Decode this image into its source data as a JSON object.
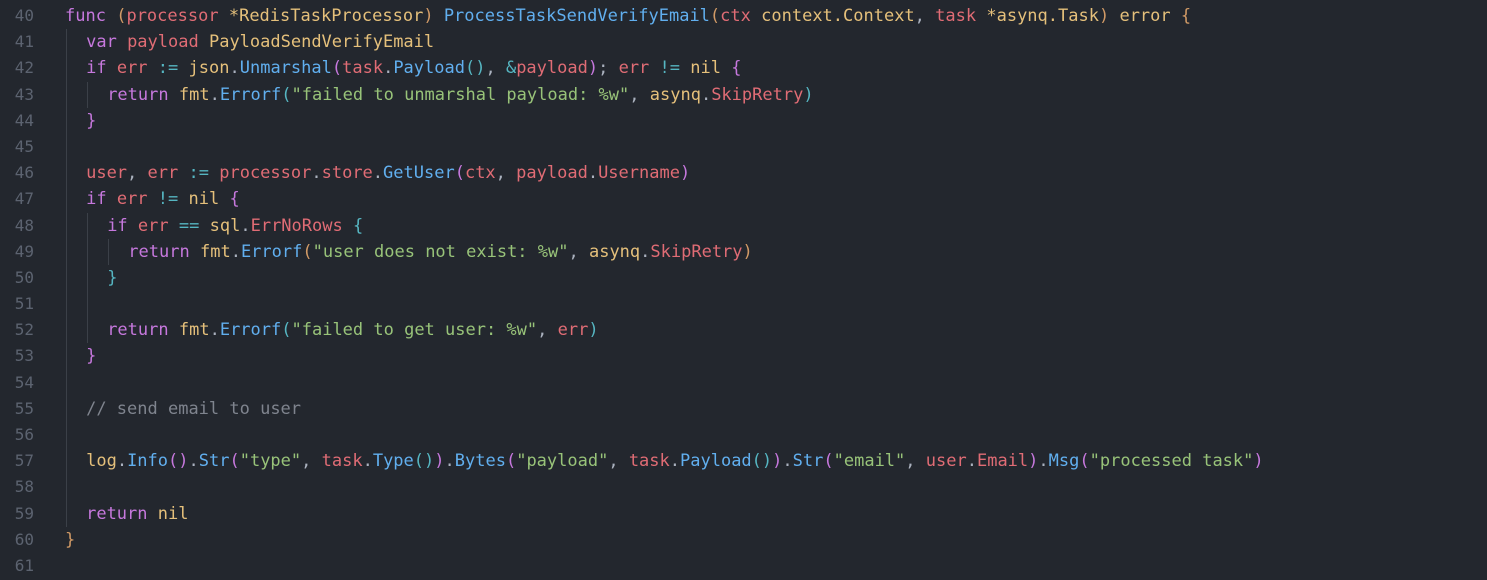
{
  "editor": {
    "colors": {
      "background": "#23272e",
      "keyword": "#c678dd",
      "function": "#61afef",
      "type": "#e5c07b",
      "variable": "#e06c75",
      "string": "#98c379",
      "operator": "#56b6c2",
      "comment": "#7f848e",
      "line_number": "#5c6370"
    },
    "lines": [
      {
        "num": "40",
        "tokens": [
          {
            "t": "func",
            "c": "kw"
          },
          {
            "t": " ",
            "c": "pl"
          },
          {
            "t": "(",
            "c": "by"
          },
          {
            "t": "processor",
            "c": "va"
          },
          {
            "t": " ",
            "c": "pl"
          },
          {
            "t": "*",
            "c": "ty"
          },
          {
            "t": "RedisTaskProcessor",
            "c": "ty"
          },
          {
            "t": ")",
            "c": "by"
          },
          {
            "t": " ",
            "c": "pl"
          },
          {
            "t": "ProcessTaskSendVerifyEmail",
            "c": "fn"
          },
          {
            "t": "(",
            "c": "by"
          },
          {
            "t": "ctx",
            "c": "va"
          },
          {
            "t": " ",
            "c": "pl"
          },
          {
            "t": "context.Context",
            "c": "ty"
          },
          {
            "t": ", ",
            "c": "pl"
          },
          {
            "t": "task",
            "c": "va"
          },
          {
            "t": " ",
            "c": "pl"
          },
          {
            "t": "*asynq.Task",
            "c": "ty"
          },
          {
            "t": ")",
            "c": "by"
          },
          {
            "t": " ",
            "c": "pl"
          },
          {
            "t": "error",
            "c": "ty"
          },
          {
            "t": " ",
            "c": "pl"
          },
          {
            "t": "{",
            "c": "by"
          }
        ]
      },
      {
        "num": "41",
        "indent": 1,
        "tokens": [
          {
            "t": "var",
            "c": "kw"
          },
          {
            "t": " ",
            "c": "pl"
          },
          {
            "t": "payload",
            "c": "va"
          },
          {
            "t": " ",
            "c": "pl"
          },
          {
            "t": "PayloadSendVerifyEmail",
            "c": "ty"
          }
        ]
      },
      {
        "num": "42",
        "indent": 1,
        "tokens": [
          {
            "t": "if",
            "c": "kw"
          },
          {
            "t": " ",
            "c": "pl"
          },
          {
            "t": "err",
            "c": "va"
          },
          {
            "t": " ",
            "c": "pl"
          },
          {
            "t": ":=",
            "c": "op"
          },
          {
            "t": " ",
            "c": "pl"
          },
          {
            "t": "json",
            "c": "ty"
          },
          {
            "t": ".",
            "c": "pl"
          },
          {
            "t": "Unmarshal",
            "c": "fn"
          },
          {
            "t": "(",
            "c": "bc"
          },
          {
            "t": "task",
            "c": "va"
          },
          {
            "t": ".",
            "c": "pl"
          },
          {
            "t": "Payload",
            "c": "fn"
          },
          {
            "t": "()",
            "c": "bb"
          },
          {
            "t": ", ",
            "c": "pl"
          },
          {
            "t": "&",
            "c": "op"
          },
          {
            "t": "payload",
            "c": "va"
          },
          {
            "t": ")",
            "c": "bc"
          },
          {
            "t": "; ",
            "c": "pl"
          },
          {
            "t": "err",
            "c": "va"
          },
          {
            "t": " ",
            "c": "pl"
          },
          {
            "t": "!=",
            "c": "op"
          },
          {
            "t": " ",
            "c": "pl"
          },
          {
            "t": "nil",
            "c": "ty"
          },
          {
            "t": " ",
            "c": "pl"
          },
          {
            "t": "{",
            "c": "bc"
          }
        ]
      },
      {
        "num": "43",
        "indent": 2,
        "tokens": [
          {
            "t": "return",
            "c": "kw"
          },
          {
            "t": " ",
            "c": "pl"
          },
          {
            "t": "fmt",
            "c": "ty"
          },
          {
            "t": ".",
            "c": "pl"
          },
          {
            "t": "Errorf",
            "c": "fn"
          },
          {
            "t": "(",
            "c": "bb"
          },
          {
            "t": "\"failed to unmarshal payload: %w\"",
            "c": "st"
          },
          {
            "t": ", ",
            "c": "pl"
          },
          {
            "t": "asynq",
            "c": "ty"
          },
          {
            "t": ".",
            "c": "pl"
          },
          {
            "t": "SkipRetry",
            "c": "va"
          },
          {
            "t": ")",
            "c": "bb"
          }
        ]
      },
      {
        "num": "44",
        "indent": 1,
        "tokens": [
          {
            "t": "}",
            "c": "bc"
          }
        ]
      },
      {
        "num": "45",
        "indent": 1,
        "tokens": []
      },
      {
        "num": "46",
        "indent": 1,
        "tokens": [
          {
            "t": "user",
            "c": "va"
          },
          {
            "t": ", ",
            "c": "pl"
          },
          {
            "t": "err",
            "c": "va"
          },
          {
            "t": " ",
            "c": "pl"
          },
          {
            "t": ":=",
            "c": "op"
          },
          {
            "t": " ",
            "c": "pl"
          },
          {
            "t": "processor",
            "c": "va"
          },
          {
            "t": ".",
            "c": "pl"
          },
          {
            "t": "store",
            "c": "va"
          },
          {
            "t": ".",
            "c": "pl"
          },
          {
            "t": "GetUser",
            "c": "fn"
          },
          {
            "t": "(",
            "c": "bc"
          },
          {
            "t": "ctx",
            "c": "va"
          },
          {
            "t": ", ",
            "c": "pl"
          },
          {
            "t": "payload",
            "c": "va"
          },
          {
            "t": ".",
            "c": "pl"
          },
          {
            "t": "Username",
            "c": "va"
          },
          {
            "t": ")",
            "c": "bc"
          }
        ]
      },
      {
        "num": "47",
        "indent": 1,
        "tokens": [
          {
            "t": "if",
            "c": "kw"
          },
          {
            "t": " ",
            "c": "pl"
          },
          {
            "t": "err",
            "c": "va"
          },
          {
            "t": " ",
            "c": "pl"
          },
          {
            "t": "!=",
            "c": "op"
          },
          {
            "t": " ",
            "c": "pl"
          },
          {
            "t": "nil",
            "c": "ty"
          },
          {
            "t": " ",
            "c": "pl"
          },
          {
            "t": "{",
            "c": "bc"
          }
        ]
      },
      {
        "num": "48",
        "indent": 2,
        "tokens": [
          {
            "t": "if",
            "c": "kw"
          },
          {
            "t": " ",
            "c": "pl"
          },
          {
            "t": "err",
            "c": "va"
          },
          {
            "t": " ",
            "c": "pl"
          },
          {
            "t": "==",
            "c": "op"
          },
          {
            "t": " ",
            "c": "pl"
          },
          {
            "t": "sql",
            "c": "ty"
          },
          {
            "t": ".",
            "c": "pl"
          },
          {
            "t": "ErrNoRows",
            "c": "va"
          },
          {
            "t": " ",
            "c": "pl"
          },
          {
            "t": "{",
            "c": "bb"
          }
        ]
      },
      {
        "num": "49",
        "indent": 3,
        "tokens": [
          {
            "t": "return",
            "c": "kw"
          },
          {
            "t": " ",
            "c": "pl"
          },
          {
            "t": "fmt",
            "c": "ty"
          },
          {
            "t": ".",
            "c": "pl"
          },
          {
            "t": "Errorf",
            "c": "fn"
          },
          {
            "t": "(",
            "c": "by"
          },
          {
            "t": "\"user does not exist: %w\"",
            "c": "st"
          },
          {
            "t": ", ",
            "c": "pl"
          },
          {
            "t": "asynq",
            "c": "ty"
          },
          {
            "t": ".",
            "c": "pl"
          },
          {
            "t": "SkipRetry",
            "c": "va"
          },
          {
            "t": ")",
            "c": "by"
          }
        ]
      },
      {
        "num": "50",
        "indent": 2,
        "tokens": [
          {
            "t": "}",
            "c": "bb"
          }
        ]
      },
      {
        "num": "51",
        "indent": 2,
        "tokens": []
      },
      {
        "num": "52",
        "indent": 2,
        "tokens": [
          {
            "t": "return",
            "c": "kw"
          },
          {
            "t": " ",
            "c": "pl"
          },
          {
            "t": "fmt",
            "c": "ty"
          },
          {
            "t": ".",
            "c": "pl"
          },
          {
            "t": "Errorf",
            "c": "fn"
          },
          {
            "t": "(",
            "c": "bb"
          },
          {
            "t": "\"failed to get user: %w\"",
            "c": "st"
          },
          {
            "t": ", ",
            "c": "pl"
          },
          {
            "t": "err",
            "c": "va"
          },
          {
            "t": ")",
            "c": "bb"
          }
        ]
      },
      {
        "num": "53",
        "indent": 1,
        "tokens": [
          {
            "t": "}",
            "c": "bc"
          }
        ]
      },
      {
        "num": "54",
        "indent": 1,
        "tokens": []
      },
      {
        "num": "55",
        "indent": 1,
        "tokens": [
          {
            "t": "// send email to user",
            "c": "cm"
          }
        ]
      },
      {
        "num": "56",
        "indent": 1,
        "tokens": []
      },
      {
        "num": "57",
        "indent": 1,
        "tokens": [
          {
            "t": "log",
            "c": "ty"
          },
          {
            "t": ".",
            "c": "pl"
          },
          {
            "t": "Info",
            "c": "fn"
          },
          {
            "t": "()",
            "c": "bc"
          },
          {
            "t": ".",
            "c": "pl"
          },
          {
            "t": "Str",
            "c": "fn"
          },
          {
            "t": "(",
            "c": "bc"
          },
          {
            "t": "\"type\"",
            "c": "st"
          },
          {
            "t": ", ",
            "c": "pl"
          },
          {
            "t": "task",
            "c": "va"
          },
          {
            "t": ".",
            "c": "pl"
          },
          {
            "t": "Type",
            "c": "fn"
          },
          {
            "t": "()",
            "c": "bb"
          },
          {
            "t": ")",
            "c": "bc"
          },
          {
            "t": ".",
            "c": "pl"
          },
          {
            "t": "Bytes",
            "c": "fn"
          },
          {
            "t": "(",
            "c": "bc"
          },
          {
            "t": "\"payload\"",
            "c": "st"
          },
          {
            "t": ", ",
            "c": "pl"
          },
          {
            "t": "task",
            "c": "va"
          },
          {
            "t": ".",
            "c": "pl"
          },
          {
            "t": "Payload",
            "c": "fn"
          },
          {
            "t": "()",
            "c": "bb"
          },
          {
            "t": ")",
            "c": "bc"
          },
          {
            "t": ".",
            "c": "pl"
          },
          {
            "t": "Str",
            "c": "fn"
          },
          {
            "t": "(",
            "c": "bc"
          },
          {
            "t": "\"email\"",
            "c": "st"
          },
          {
            "t": ", ",
            "c": "pl"
          },
          {
            "t": "user",
            "c": "va"
          },
          {
            "t": ".",
            "c": "pl"
          },
          {
            "t": "Email",
            "c": "va"
          },
          {
            "t": ")",
            "c": "bc"
          },
          {
            "t": ".",
            "c": "pl"
          },
          {
            "t": "Msg",
            "c": "fn"
          },
          {
            "t": "(",
            "c": "bc"
          },
          {
            "t": "\"processed task\"",
            "c": "st"
          },
          {
            "t": ")",
            "c": "bc"
          }
        ]
      },
      {
        "num": "58",
        "indent": 1,
        "tokens": []
      },
      {
        "num": "59",
        "indent": 1,
        "tokens": [
          {
            "t": "return",
            "c": "kw"
          },
          {
            "t": " ",
            "c": "pl"
          },
          {
            "t": "nil",
            "c": "ty"
          }
        ]
      },
      {
        "num": "60",
        "tokens": [
          {
            "t": "}",
            "c": "by"
          }
        ]
      },
      {
        "num": "61",
        "tokens": []
      }
    ]
  }
}
